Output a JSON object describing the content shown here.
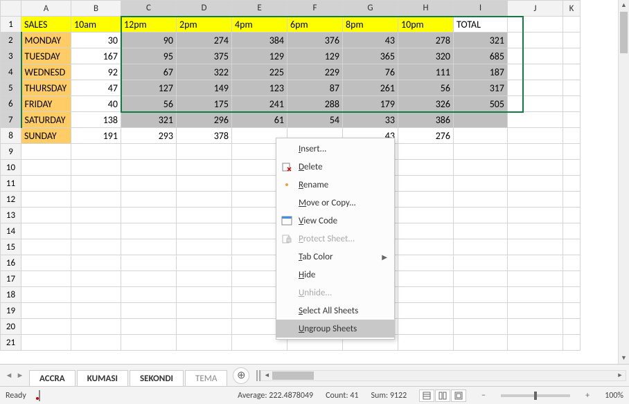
{
  "columns": [
    "A",
    "B",
    "C",
    "D",
    "E",
    "F",
    "G",
    "H",
    "I",
    "J",
    "K"
  ],
  "rows": [
    1,
    2,
    3,
    4,
    5,
    6,
    7,
    8,
    9,
    10,
    11,
    12,
    13,
    14,
    15,
    16,
    17,
    18,
    19,
    20,
    21
  ],
  "header_row": {
    "A": "SALES",
    "B": "10am",
    "C": "12pm",
    "D": "2pm",
    "E": "4pm",
    "F": "6pm",
    "G": "8pm",
    "H": "10pm",
    "I": "TOTAL"
  },
  "data_rows": [
    {
      "day": "MONDAY",
      "vals": [
        30,
        90,
        274,
        384,
        376,
        43,
        278
      ],
      "total": 321
    },
    {
      "day": "TUESDAY",
      "vals": [
        167,
        95,
        375,
        129,
        129,
        365,
        320
      ],
      "total": 685
    },
    {
      "day": "WEDNESDAY",
      "display_day": "WEDNESD",
      "vals": [
        92,
        67,
        322,
        225,
        229,
        76,
        111
      ],
      "total": 187
    },
    {
      "day": "THURSDAY",
      "vals": [
        47,
        127,
        149,
        123,
        87,
        261,
        56
      ],
      "total": 317
    },
    {
      "day": "FRIDAY",
      "vals": [
        40,
        56,
        175,
        241,
        288,
        179,
        326
      ],
      "total": 505
    },
    {
      "day": "SATURDAY",
      "vals": [
        138,
        321,
        296,
        61,
        54,
        33,
        386
      ],
      "total": ""
    },
    {
      "day": "SUNDAY",
      "vals": [
        191,
        293,
        378,
        "",
        "",
        43,
        276
      ],
      "total": ""
    }
  ],
  "tabs": [
    "ACCRA",
    "KUMASI",
    "SEKONDI",
    "TEMA"
  ],
  "context_menu": [
    {
      "label": "Insert...",
      "key": "I",
      "icon": "",
      "enabled": true
    },
    {
      "label": "Delete",
      "key": "D",
      "icon": "delete-sheet",
      "enabled": true
    },
    {
      "label": "Rename",
      "key": "R",
      "icon": "dot",
      "enabled": true
    },
    {
      "label": "Move or Copy...",
      "key": "M",
      "icon": "",
      "enabled": true
    },
    {
      "label": "View Code",
      "key": "V",
      "icon": "view-code",
      "enabled": true
    },
    {
      "label": "Protect Sheet...",
      "key": "P",
      "icon": "protect",
      "enabled": false
    },
    {
      "label": "Tab Color",
      "key": "T",
      "icon": "",
      "enabled": true,
      "submenu": true
    },
    {
      "label": "Hide",
      "key": "H",
      "icon": "",
      "enabled": true
    },
    {
      "label": "Unhide...",
      "key": "U",
      "icon": "",
      "enabled": false
    },
    {
      "label": "Select All Sheets",
      "key": "S",
      "icon": "",
      "enabled": true
    },
    {
      "label": "Ungroup Sheets",
      "key": "U",
      "icon": "",
      "enabled": true,
      "hover": true
    }
  ],
  "status": {
    "ready": "Ready",
    "average_label": "Average:",
    "average": "222.4878049",
    "count_label": "Count:",
    "count": "41",
    "sum_label": "Sum:",
    "sum": "9122",
    "zoom": "100%"
  },
  "chart_data": {
    "type": "table",
    "title": "SALES",
    "columns": [
      "10am",
      "12pm",
      "2pm",
      "4pm",
      "6pm",
      "8pm",
      "10pm",
      "TOTAL"
    ],
    "rows": [
      "MONDAY",
      "TUESDAY",
      "WEDNESDAY",
      "THURSDAY",
      "FRIDAY",
      "SATURDAY",
      "SUNDAY"
    ],
    "values": [
      [
        30,
        90,
        274,
        384,
        376,
        43,
        278,
        321
      ],
      [
        167,
        95,
        375,
        129,
        129,
        365,
        320,
        685
      ],
      [
        92,
        67,
        322,
        225,
        229,
        76,
        111,
        187
      ],
      [
        47,
        127,
        149,
        123,
        87,
        261,
        56,
        317
      ],
      [
        40,
        56,
        175,
        241,
        288,
        179,
        326,
        505
      ],
      [
        138,
        321,
        296,
        61,
        54,
        33,
        386,
        null
      ],
      [
        191,
        293,
        378,
        null,
        null,
        43,
        276,
        null
      ]
    ],
    "selection": "C2:I7",
    "aggregate": {
      "average": 222.4878049,
      "count": 41,
      "sum": 9122
    }
  }
}
